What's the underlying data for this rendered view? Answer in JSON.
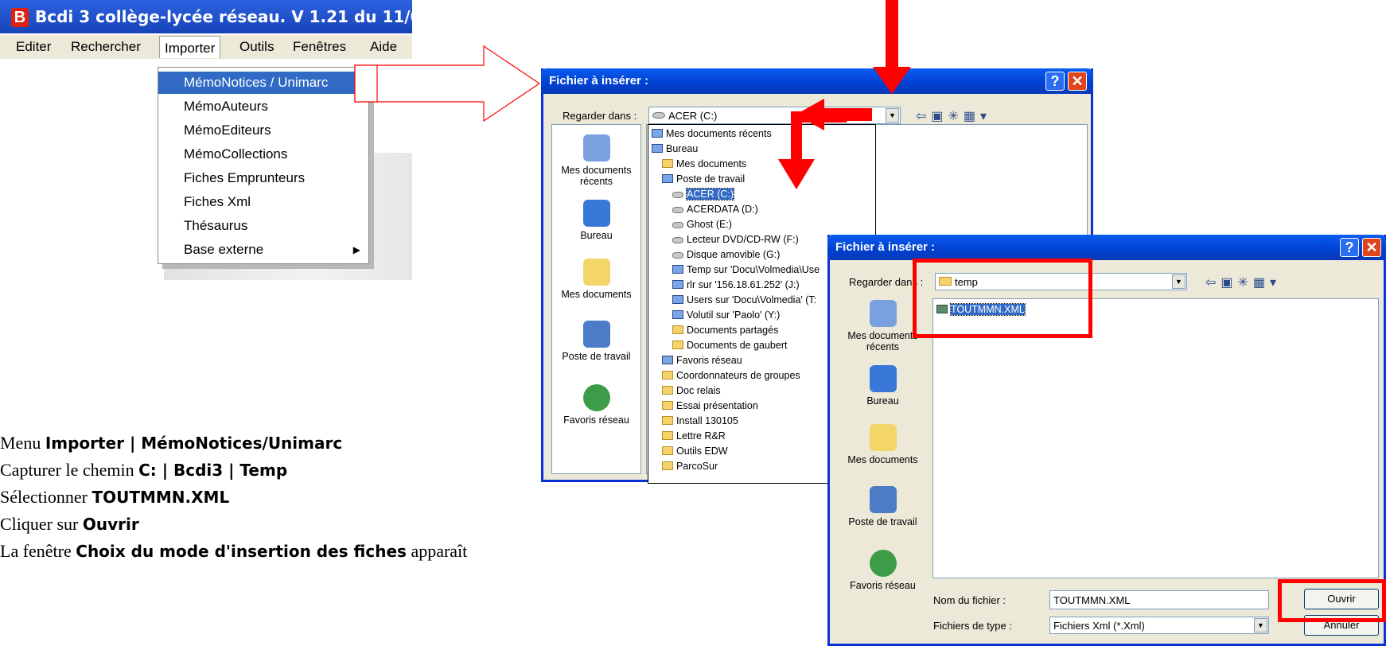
{
  "app": {
    "title": "Bcdi 3 collège-lycée réseau. V 1.21 du 11/0",
    "logo": "B",
    "menu": [
      "Editer",
      "Rechercher",
      "Importer",
      "Outils",
      "Fenêtres",
      "Aide"
    ],
    "importer_items": [
      "MémoNotices / Unimarc",
      "MémoAuteurs",
      "MémoEditeurs",
      "MémoCollections",
      "Fiches Emprunteurs",
      "Fiches Xml",
      "Thésaurus",
      "Base externe"
    ]
  },
  "instructions": {
    "l1_pre": "Menu ",
    "l1_b": "Importer | MémoNotices/Unimarc",
    "l2_pre": "Capturer le chemin ",
    "l2_b": "C: | Bcdi3 | Temp",
    "l3_pre": "Sélectionner ",
    "l3_b": "TOUTMMN.XML",
    "l4_pre": "Cliquer sur ",
    "l4_b": "Ouvrir",
    "l5_pre": "La fenêtre ",
    "l5_b": "Choix du mode d'insertion des fiches",
    "l5_post": " apparaît"
  },
  "dialog1": {
    "title": "Fichier à insérer :",
    "look_in_label": "Regarder dans :",
    "look_in_value": "ACER (C:)",
    "places": [
      "Mes documents récents",
      "Bureau",
      "Mes documents",
      "Poste de travail",
      "Favoris réseau"
    ],
    "tree": [
      "Mes documents récents",
      "Bureau",
      "Mes documents",
      "Poste de travail",
      "ACER (C:)",
      "ACERDATA (D:)",
      "Ghost (E:)",
      "Lecteur DVD/CD-RW (F:)",
      "Disque amovible (G:)",
      "Temp sur 'Docu\\Volmedia\\Use",
      "rlr sur '156.18.61.252' (J:)",
      "Users sur 'Docu\\Volmedia' (T:",
      "Volutil sur 'Paolo' (Y:)",
      "Documents partagés",
      "Documents de gaubert",
      "Favoris réseau",
      "Coordonnateurs de groupes",
      "Doc relais",
      "Essai présentation",
      "Install 130105",
      "Lettre R&R",
      "Outils EDW",
      "ParcoSur"
    ]
  },
  "dialog2": {
    "title": "Fichier à insérer :",
    "look_in_label": "Regarder dans :",
    "look_in_value": "temp",
    "places": [
      "Mes documents récents",
      "Bureau",
      "Mes documents",
      "Poste de travail",
      "Favoris réseau"
    ],
    "file": "TOUTMMN.XML",
    "filename_label": "Nom du fichier :",
    "filename_value": "TOUTMMN.XML",
    "filetype_label": "Fichiers de type :",
    "filetype_value": "Fichiers Xml (*.Xml)",
    "open_button": "Ouvrir",
    "cancel_button": "Annuler"
  },
  "colors": {
    "annotation": "#ff0000",
    "xp_title": "#0a5cf0",
    "selection": "#316ac5"
  }
}
